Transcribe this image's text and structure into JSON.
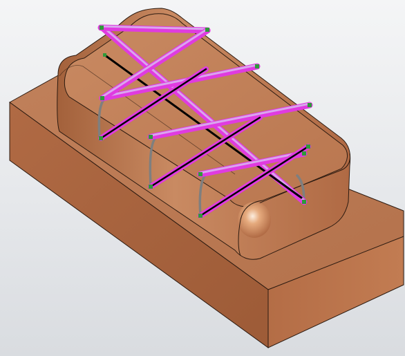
{
  "viewport": {
    "background": "#e9ebee",
    "model": {
      "shading": "shaded-with-edges",
      "material_color": "#b9764f",
      "edge_color": "#2b1a10",
      "grid_line_color": "#e03be0",
      "highlight_line_color": "#d9a6ee",
      "centerline_color": "#000000",
      "endpoint_color": "#2e9a3a",
      "support_color": "#8b8b8b"
    }
  }
}
